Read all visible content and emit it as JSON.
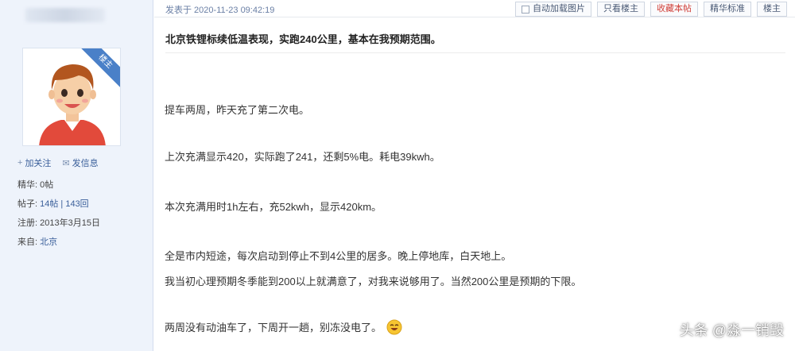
{
  "post": {
    "time": "发表于 2020-11-23 09:42:19",
    "title": "北京铁锂标续低温表现，实跑240公里，基本在我预期范围。",
    "paragraphs": [
      "提车两周，昨天充了第二次电。",
      "上次充满显示420，实际跑了241，还剩5%电。耗电39kwh。",
      "本次充满用时1h左右，充52kwh，显示420km。",
      "全是市内短途，每次启动到停止不到4公里的居多。晚上停地库，白天地上。",
      "我当初心理预期冬季能到200以上就满意了，对我来说够用了。当然200公里是预期的下限。",
      "两周没有动油车了，下周开一趟，别冻没电了。"
    ]
  },
  "toolbar": {
    "auto_load_label": "自动加载图片",
    "only_owner_label": "只看楼主",
    "favorite_label": "收藏本帖",
    "featured_label": "精华标准",
    "floor_label": "楼主"
  },
  "sidebar": {
    "badge": "楼主",
    "follow_label": "加关注",
    "message_label": "发信息",
    "stats": {
      "elite_label": "精华:",
      "elite_value": "0帖",
      "posts_label": "帖子:",
      "posts_value": "14帖 | 143回",
      "reg_label": "注册:",
      "reg_value": "2013年3月15日",
      "from_label": "来自:",
      "from_value": "北京"
    }
  },
  "watermark": "头条 @淼一销毁",
  "colors": {
    "accent": "#4a80c8",
    "link": "#3a5f9a",
    "favorite": "#d0413a"
  }
}
